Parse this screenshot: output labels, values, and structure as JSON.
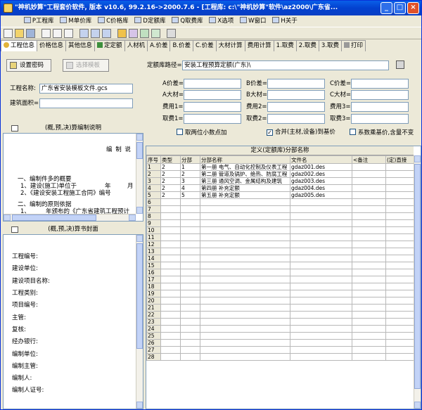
{
  "window": {
    "title": "\"神机妙算\"工程套价软件, 版本 v10.6, 99.2.16->2000.7.6 - [工程库: c:\\\"神机妙算\"软件\\az2000\\广东省...",
    "min": "_",
    "max": "□",
    "close": "×"
  },
  "menu": [
    "P工程库",
    "M单价库",
    "C价格库",
    "D定额库",
    "Q取费库",
    "X选项",
    "W窗口",
    "H关于"
  ],
  "tabs": [
    "工程信息",
    "价格信息",
    "其他信息",
    "定定额",
    "人材机",
    "A.价差",
    "B.价差",
    "C.价差",
    "大材计算",
    "费用计算",
    "1.取费",
    "2.取费",
    "3.取费",
    "打印"
  ],
  "left": {
    "set_password": "设置密码",
    "choose_template": "选择模板",
    "project_name_label": "工程名称:",
    "project_name_value": "广东省安装模板文件.gcs",
    "area_label": "建筑面积=",
    "area_value": "",
    "notes_header": "(概,预,决)算编制说明",
    "notes_lines": [
      "编 制 说",
      "一、编制件多的概要",
      "1、建设(施工)单位于",
      "年",
      "月",
      "2、《建设安装工程施工合同》编号",
      "二、编制的原则依据",
      "1、",
      "年颁布的《广东省建筑工程预计"
    ],
    "cover_header": "(概,预,决)算书封面",
    "cover_lines": [
      "工程编号:",
      "建设单位:",
      "建设项目名称:",
      "工程类别:",
      "项目编号:",
      "主管:",
      "复核:",
      "经办银行:",
      "编制单位:",
      "编制主管:",
      "编制人:",
      "编制人证号:"
    ]
  },
  "right": {
    "lib_label": "定额库路径=",
    "lib_value": "安装工程预算定额(广东)\\",
    "fields": [
      [
        "A价差=",
        "B价差=",
        "C价差="
      ],
      [
        "A大材=",
        "B大材=",
        "C大材="
      ],
      [
        "费用1=",
        "费用2=",
        "费用3="
      ],
      [
        "取费1=",
        "取费2=",
        "取费3="
      ]
    ],
    "check1": "取两位小数点加",
    "check2": "合并(主材,设备)到基价",
    "check3": "系数乘基价,含量不变",
    "check2_mark": "✓",
    "grid_caption": "定义(定额库)分部名称",
    "grid_headers": [
      "序号",
      "类型",
      "分部",
      "分部名称",
      "文件名",
      "<备注",
      "(定)直接"
    ],
    "grid_rows": [
      [
        "1",
        "2",
        "1",
        "第一册 电气、自动化控制及仪表工程",
        "gdaz001.des",
        "",
        ""
      ],
      [
        "2",
        "2",
        "2",
        "第二册 管道及锅炉、绝热、防腐工程",
        "gdaz002.des",
        "",
        ""
      ],
      [
        "3",
        "2",
        "3",
        "第三册 通风空调、金属结构及建筑",
        "gdaz003.des",
        "",
        ""
      ],
      [
        "4",
        "2",
        "4",
        "第四册 补充定额",
        "gdaz004.des",
        "",
        ""
      ],
      [
        "5",
        "2",
        "5",
        "第五册 补充定额",
        "gdaz005.des",
        "",
        ""
      ]
    ],
    "empty_row_numbers": [
      "6",
      "7",
      "8",
      "9",
      "10",
      "11",
      "12",
      "13",
      "14",
      "15",
      "16",
      "17",
      "18",
      "19",
      "20",
      "21",
      "22",
      "23",
      "24",
      "25",
      "26",
      "27",
      "28"
    ]
  }
}
